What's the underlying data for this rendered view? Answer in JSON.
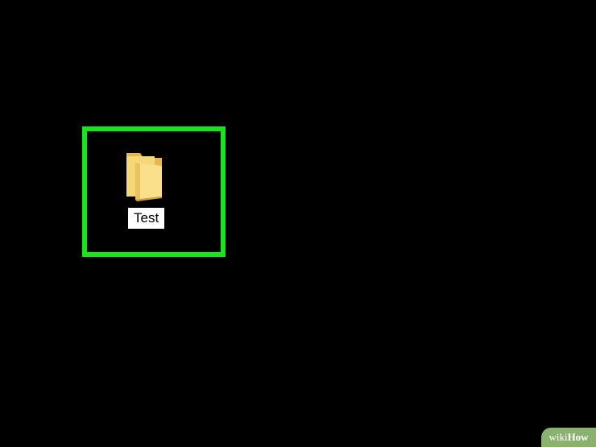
{
  "desktop": {
    "background": "#000000",
    "highlight_color": "#18e51a",
    "folder": {
      "label": "Test",
      "icon": "folder-icon",
      "icon_color": "#f5d77a"
    }
  },
  "watermark": {
    "wiki": "wiki",
    "how": "How",
    "color": "#8ab16d"
  }
}
